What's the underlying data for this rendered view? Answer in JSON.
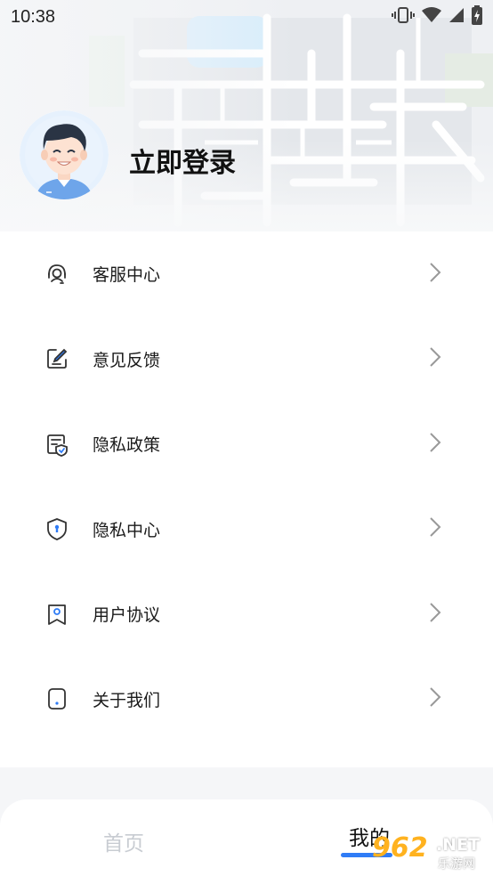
{
  "status_bar": {
    "time": "10:38",
    "icons": [
      "vibrate-icon",
      "wifi-icon",
      "signal-icon",
      "battery-icon"
    ]
  },
  "profile": {
    "login_label": "立即登录",
    "avatar_icon": "avatar-icon"
  },
  "menu": {
    "items": [
      {
        "label": "客服中心",
        "icon": "headset-icon"
      },
      {
        "label": "意见反馈",
        "icon": "feedback-edit-icon"
      },
      {
        "label": "隐私政策",
        "icon": "policy-doc-icon"
      },
      {
        "label": "隐私中心",
        "icon": "shield-icon"
      },
      {
        "label": "用户协议",
        "icon": "bookmark-icon"
      },
      {
        "label": "关于我们",
        "icon": "about-icon"
      }
    ]
  },
  "tabbar": {
    "home_label": "首页",
    "mine_label": "我的",
    "active_tab": "我的",
    "accent_color": "#2f7cf6"
  },
  "watermark": {
    "big": "962",
    "net": ".NET",
    "cn": "乐游网"
  }
}
